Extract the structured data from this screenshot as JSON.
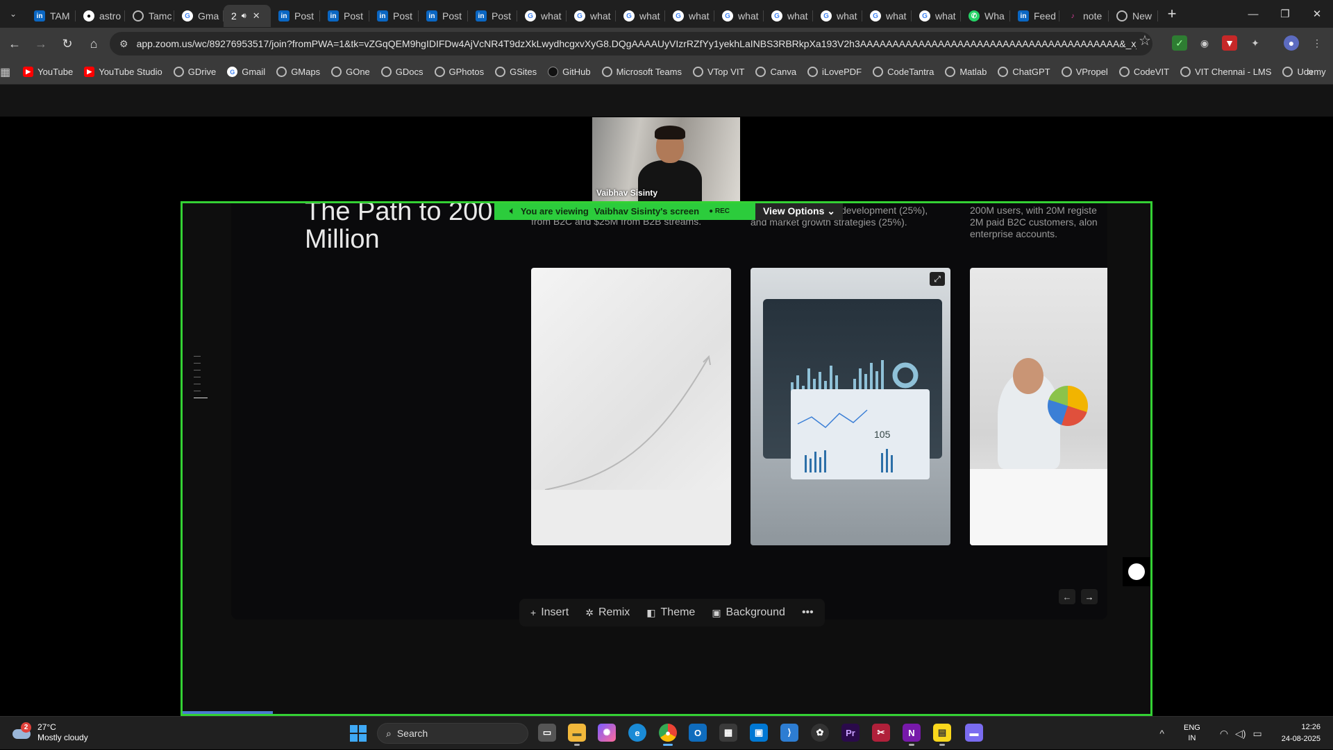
{
  "browser": {
    "tabs": [
      {
        "icon": "linkedin",
        "label": "TAM"
      },
      {
        "icon": "github",
        "label": "astro"
      },
      {
        "icon": "web",
        "label": "Tamc"
      },
      {
        "icon": "google",
        "label": "Gma"
      },
      {
        "icon": "audio",
        "label": "2",
        "active": true
      },
      {
        "icon": "linkedin",
        "label": "Post"
      },
      {
        "icon": "linkedin",
        "label": "Post"
      },
      {
        "icon": "linkedin",
        "label": "Post"
      },
      {
        "icon": "linkedin",
        "label": "Post"
      },
      {
        "icon": "linkedin",
        "label": "Post"
      },
      {
        "icon": "google",
        "label": "what"
      },
      {
        "icon": "google",
        "label": "what"
      },
      {
        "icon": "google",
        "label": "what"
      },
      {
        "icon": "google",
        "label": "what"
      },
      {
        "icon": "google",
        "label": "what"
      },
      {
        "icon": "google",
        "label": "what"
      },
      {
        "icon": "google",
        "label": "what"
      },
      {
        "icon": "google",
        "label": "what"
      },
      {
        "icon": "google",
        "label": "what"
      },
      {
        "icon": "whatsapp",
        "label": "Wha"
      },
      {
        "icon": "linkedin",
        "label": "Feed"
      },
      {
        "icon": "note",
        "label": "note"
      },
      {
        "icon": "web",
        "label": "New"
      }
    ],
    "url": "app.zoom.us/wc/89276953517/join?fromPWA=1&tk=vZGqQEM9hgIDIFDw4AjVcNR4T9dzXkLwydhcgxvXyG8.DQgAAAAUyVIzrRZfYy1yekhLaINBS3RBRkpXa193V2h3AAAAAAAAAAAAAAAAAAAAAAAAAAAAAAAAAAAAAAAA&_x_zm_r...",
    "bookmarks": [
      "YouTube",
      "YouTube Studio",
      "GDrive",
      "Gmail",
      "GMaps",
      "GOne",
      "GDocs",
      "GPhotos",
      "GSites",
      "GitHub",
      "Microsoft Teams",
      "VTop VIT",
      "Canva",
      "iLovePDF",
      "CodeTantra",
      "Matlab",
      "ChatGPT",
      "VPropel",
      "CodeVIT",
      "VIT Chennai - LMS",
      "Udemy"
    ]
  },
  "zoom": {
    "participant_name": "Vaibhav Sisinty",
    "banner_prefix": "You are viewing",
    "banner_name": "Vaibhav Sisinty's screen",
    "rec_label": "REC",
    "view_options": "View Options"
  },
  "slide": {
    "title": "The Path to 200 Million",
    "col1_text": "from B2C and $25M from B2B streams.",
    "col2_text": "ation (30%), product development (25%), and market growth strategies (25%).",
    "col3_text": "200M users, with 20M registe 2M paid B2C customers, alon enterprise accounts.",
    "chart_value": "105"
  },
  "editor_toolbar": {
    "insert": "Insert",
    "remix": "Remix",
    "theme": "Theme",
    "background": "Background"
  },
  "taskbar": {
    "weather_temp": "27°C",
    "weather_desc": "Mostly cloudy",
    "weather_badge": "2",
    "search": "Search",
    "lang1": "ENG",
    "lang2": "IN",
    "time": "12:26",
    "date": "24-08-2025"
  }
}
